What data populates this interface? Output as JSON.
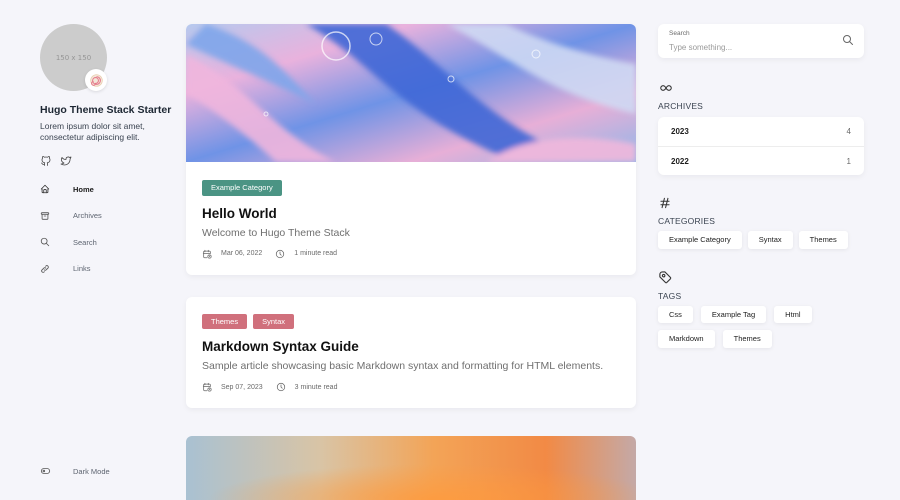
{
  "sidebar": {
    "avatar_placeholder": "150 x 150",
    "avatar_emoji": "🍥",
    "site_name": "Hugo Theme Stack Starter",
    "site_description": "Lorem ipsum dolor sit amet, consectetur adipiscing elit.",
    "social": [
      {
        "icon": "github-icon"
      },
      {
        "icon": "twitter-icon"
      }
    ],
    "menu": [
      {
        "label": "Home",
        "icon": "home-icon",
        "active": true
      },
      {
        "label": "Archives",
        "icon": "archive-icon",
        "active": false
      },
      {
        "label": "Search",
        "icon": "search-icon",
        "active": false
      },
      {
        "label": "Links",
        "icon": "link-icon",
        "active": false
      }
    ],
    "dark_mode_label": "Dark Mode"
  },
  "articles": [
    {
      "categories": [
        {
          "label": "Example Category",
          "color": "#4b9484"
        }
      ],
      "title": "Hello World",
      "subtitle": "Welcome to Hugo Theme Stack",
      "date": "Mar 06, 2022",
      "read_time": "1 minute read"
    },
    {
      "categories": [
        {
          "label": "Themes",
          "color": "#d0707c"
        },
        {
          "label": "Syntax",
          "color": "#d0707c"
        }
      ],
      "title": "Markdown Syntax Guide",
      "subtitle": "Sample article showcasing basic Markdown syntax and formatting for HTML elements.",
      "date": "Sep 07, 2023",
      "read_time": "3 minute read"
    }
  ],
  "search": {
    "label": "Search",
    "placeholder": "Type something..."
  },
  "archives": {
    "title": "ARCHIVES",
    "years": [
      {
        "year": "2023",
        "count": "4"
      },
      {
        "year": "2022",
        "count": "1"
      }
    ]
  },
  "categories": {
    "title": "CATEGORIES",
    "items": [
      "Example Category",
      "Syntax",
      "Themes"
    ]
  },
  "tags": {
    "title": "TAGS",
    "items": [
      "Css",
      "Example Tag",
      "Html",
      "Markdown",
      "Themes"
    ]
  },
  "colors": {
    "background": "#f5f5fa",
    "card": "#ffffff",
    "category_green": "#4b9484",
    "category_pink": "#d0707c"
  }
}
